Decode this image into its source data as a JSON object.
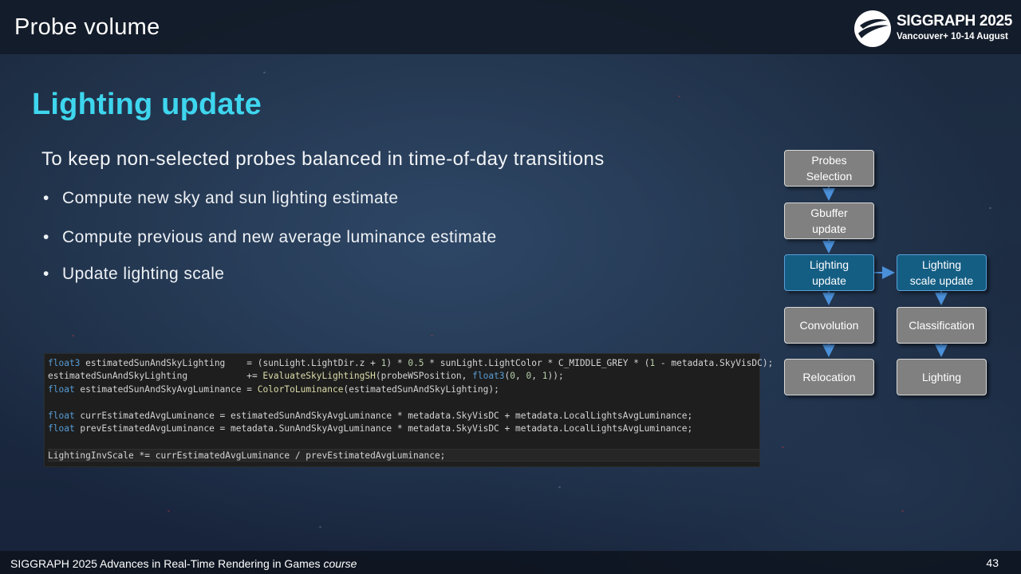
{
  "header": {
    "section_title": "Probe volume",
    "logo": {
      "name": "SIGGRAPH 2025",
      "subtitle": "Vancouver+ 10-14 August"
    }
  },
  "slide": {
    "heading": "Lighting update",
    "intro": "To keep non-selected probes balanced in time-of-day transitions",
    "bullets": [
      "Compute new sky and sun lighting estimate",
      "Compute previous and new average luminance estimate",
      "Update lighting scale"
    ]
  },
  "code": {
    "lines": [
      "float3 estimatedSunAndSkyLighting    = (sunLight.LightDir.z + 1) * 0.5 * sunLight.LightColor * C_MIDDLE_GREY * (1 - metadata.SkyVisDC);",
      "estimatedSunAndSkyLighting           += EvaluateSkyLightingSH(probeWSPosition, float3(0, 0, 1));",
      "float estimatedSunAndSkyAvgLuminance = ColorToLuminance(estimatedSunAndSkyLighting);",
      "",
      "float currEstimatedAvgLuminance = estimatedSunAndSkyAvgLuminance * metadata.SkyVisDC + metadata.LocalLightsAvgLuminance;",
      "float prevEstimatedAvgLuminance = metadata.SunAndSkyAvgLuminance * metadata.SkyVisDC + metadata.LocalLightsAvgLuminance;",
      "",
      "LightingInvScale *= currEstimatedAvgLuminance / prevEstimatedAvgLuminance;"
    ]
  },
  "diagram": {
    "nodes": {
      "probes_selection": {
        "line1": "Probes",
        "line2": "Selection"
      },
      "gbuffer_update": {
        "line1": "Gbuffer",
        "line2": "update"
      },
      "lighting_update": {
        "line1": "Lighting",
        "line2": "update"
      },
      "lighting_scale_update": {
        "line1": "Lighting",
        "line2": "scale update"
      },
      "convolution": {
        "line1": "Convolution"
      },
      "classification": {
        "line1": "Classification"
      },
      "relocation": {
        "line1": "Relocation"
      },
      "lighting": {
        "line1": "Lighting"
      }
    },
    "colors": {
      "highlight": "#145e84",
      "default": "#808080",
      "arrow": "#4a90d9"
    }
  },
  "footer": {
    "course_text": "SIGGRAPH 2025 Advances in Real-Time Rendering in Games ",
    "course_suffix": "course",
    "page_number": "43"
  }
}
